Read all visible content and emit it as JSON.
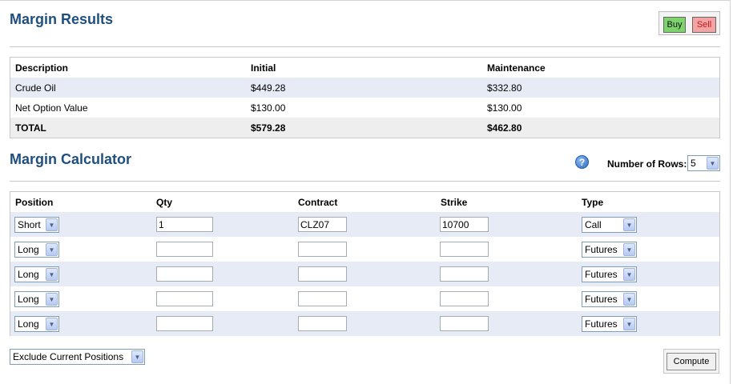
{
  "results": {
    "title": "Margin Results",
    "buy_label": "Buy",
    "sell_label": "Sell",
    "columns": [
      "Description",
      "Initial",
      "Maintenance"
    ],
    "rows": [
      {
        "description": "Crude Oil",
        "initial": "$449.28",
        "maintenance": "$332.80"
      },
      {
        "description": "Net Option Value",
        "initial": "$130.00",
        "maintenance": "$130.00"
      }
    ],
    "total": {
      "description": "TOTAL",
      "initial": "$579.28",
      "maintenance": "$462.80"
    }
  },
  "calculator": {
    "title": "Margin Calculator",
    "help_icon": "question-circle-icon",
    "rows_label": "Number of Rows:",
    "rows_value": "5",
    "columns": [
      "Position",
      "Qty",
      "Contract",
      "Strike",
      "Type"
    ],
    "rows": [
      {
        "position": "Short",
        "qty": "1",
        "contract": "CLZ07",
        "strike": "10700",
        "type": "Call"
      },
      {
        "position": "Long",
        "qty": "",
        "contract": "",
        "strike": "",
        "type": "Futures"
      },
      {
        "position": "Long",
        "qty": "",
        "contract": "",
        "strike": "",
        "type": "Futures"
      },
      {
        "position": "Long",
        "qty": "",
        "contract": "",
        "strike": "",
        "type": "Futures"
      },
      {
        "position": "Long",
        "qty": "",
        "contract": "",
        "strike": "",
        "type": "Futures"
      }
    ],
    "exclude_option": "Exclude Current Positions",
    "compute_label": "Compute"
  },
  "colors": {
    "title": "#1f4f7f",
    "alt_row": "#e6ebf5",
    "buy": "#7ed46c",
    "sell": "#f4a4a4"
  }
}
